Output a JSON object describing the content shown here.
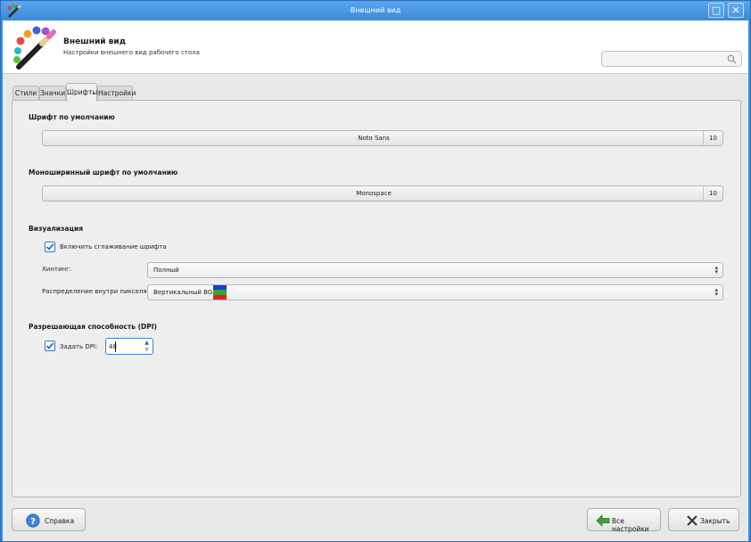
{
  "window": {
    "title": "Внешний вид",
    "icons": {
      "app": "paint-brush-icon",
      "maximize": "maximize-icon",
      "close": "close-icon"
    }
  },
  "header": {
    "title": "Внешний вид",
    "subtitle": "Настройки внешнего вид рабочего стола",
    "icon": "palette-brush-icon",
    "search": {
      "placeholder": "",
      "icon": "search-icon"
    }
  },
  "tabs": [
    {
      "label": "Стили",
      "active": false
    },
    {
      "label": "Значки",
      "active": false
    },
    {
      "label": "Шрифты",
      "active": true
    },
    {
      "label": "Настройки",
      "active": false
    }
  ],
  "fonts": {
    "default_title": "Шрифт по умолчанию",
    "default_font": {
      "name": "Noto Sans",
      "size": "10"
    },
    "mono_title": "Моноширинный шрифт по умолчанию",
    "mono_font": {
      "name": "Monospace",
      "size": "10"
    }
  },
  "rendering": {
    "title": "Визуализация",
    "antialias": {
      "label": "Включить сглаживание шрифта",
      "checked": true
    },
    "hinting": {
      "label": "Хинтинг:",
      "value": "Полный"
    },
    "subpixel": {
      "label": "Распределение внутри пикселя:",
      "value": "Вертикальный BGR",
      "swatch_colors": [
        "#1f3bd6",
        "#22b422",
        "#e02020"
      ]
    }
  },
  "dpi": {
    "title": "Разрешающая способность (DPI)",
    "checkbox": {
      "label": "Задать DPI:",
      "checked": true
    },
    "value": "48"
  },
  "buttons": {
    "help": {
      "label": "Справка",
      "icon": "help-icon"
    },
    "all_settings": {
      "label": "Все настройки",
      "icon": "back-arrow-icon"
    },
    "close": {
      "label": "Закрыть",
      "icon": "close-x-icon"
    }
  },
  "colors": {
    "titlebar": "#3b8ad8",
    "accent": "#3a76b7"
  }
}
